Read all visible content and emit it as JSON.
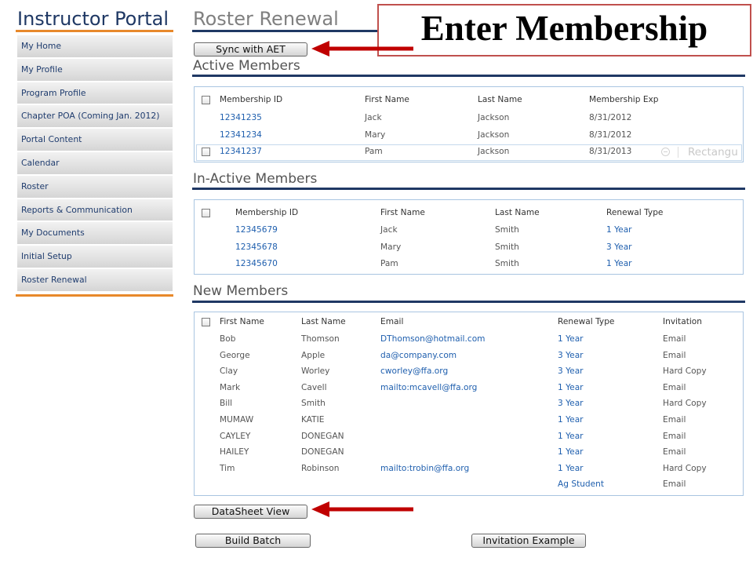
{
  "sidebar": {
    "title": "Instructor Portal",
    "items": [
      {
        "label": "My Home"
      },
      {
        "label": "My Profile"
      },
      {
        "label": "Program Profile"
      },
      {
        "label": "Chapter POA (Coming Jan. 2012)"
      },
      {
        "label": "Portal Content"
      },
      {
        "label": "Calendar"
      },
      {
        "label": "Roster"
      },
      {
        "label": "Reports & Communication"
      },
      {
        "label": "My Documents"
      },
      {
        "label": "Initial Setup"
      },
      {
        "label": "Roster Renewal"
      }
    ]
  },
  "main": {
    "title": "Roster Renewal",
    "sync_button": "Sync with AET",
    "active": {
      "heading": "Active Members",
      "columns": [
        "Membership ID",
        "First Name",
        "Last Name",
        "Membership Exp"
      ],
      "rows": [
        {
          "id": "12341235",
          "first": "Jack",
          "last": "Jackson",
          "exp": "8/31/2012"
        },
        {
          "id": "12341234",
          "first": "Mary",
          "last": "Jackson",
          "exp": "8/31/2012"
        },
        {
          "id": "12341237",
          "first": "Pam",
          "last": "Jackson",
          "exp": "8/31/2013",
          "hovered": true
        }
      ]
    },
    "inactive": {
      "heading": "In-Active Members",
      "columns": [
        "Membership ID",
        "First Name",
        "Last Name",
        "Renewal Type"
      ],
      "rows": [
        {
          "id": "12345679",
          "first": "Jack",
          "last": "Smith",
          "renewal": "1 Year"
        },
        {
          "id": "12345678",
          "first": "Mary",
          "last": "Smith",
          "renewal": "3 Year"
        },
        {
          "id": "12345670",
          "first": "Pam",
          "last": "Smith",
          "renewal": "1 Year"
        }
      ]
    },
    "new_members": {
      "heading": "New Members",
      "columns": [
        "First Name",
        "Last Name",
        "Email",
        "Renewal Type",
        "Invitation"
      ],
      "rows": [
        {
          "first": "Bob",
          "last": "Thomson",
          "email": "DThomson@hotmail.com",
          "renewal": "1 Year",
          "invitation": "Email"
        },
        {
          "first": "George",
          "last": "Apple",
          "email": "da@company.com",
          "renewal": "3 Year",
          "invitation": "Email"
        },
        {
          "first": "Clay",
          "last": "Worley",
          "email": "cworley@ffa.org",
          "renewal": "3 Year",
          "invitation": "Hard Copy"
        },
        {
          "first": "Mark",
          "last": "Cavell",
          "email": "mailto:mcavell@ffa.org",
          "renewal": "1 Year",
          "invitation": "Email"
        },
        {
          "first": "Bill",
          "last": "Smith",
          "email": "",
          "renewal": "3 Year",
          "invitation": "Hard Copy"
        },
        {
          "first": "MUMAW",
          "last": "KATIE",
          "email": "",
          "renewal": "1 Year",
          "invitation": "Email"
        },
        {
          "first": "CAYLEY",
          "last": "DONEGAN",
          "email": "",
          "renewal": "1 Year",
          "invitation": "Email"
        },
        {
          "first": "HAILEY",
          "last": "DONEGAN",
          "email": "",
          "renewal": "1 Year",
          "invitation": "Email"
        },
        {
          "first": "Tim",
          "last": "Robinson",
          "email": "mailto:trobin@ffa.org",
          "renewal": "1 Year",
          "invitation": "Hard Copy"
        },
        {
          "first": "",
          "last": "",
          "email": "",
          "renewal": "Ag Student",
          "invitation": "Email"
        }
      ]
    },
    "buttons": {
      "datasheet_view": "DataSheet View",
      "build_batch": "Build Batch",
      "invitation_example": "Invitation Example"
    }
  },
  "annotation": {
    "callout": "Enter Membership"
  },
  "overlay": {
    "label": "Rectangu"
  },
  "colors": {
    "navy_rule": "#1f3864",
    "orange_rule": "#e8892b",
    "link": "#1f5fae",
    "callout_border": "#c0504d",
    "arrow": "#c00000",
    "grid_border": "#a9c5e1"
  }
}
